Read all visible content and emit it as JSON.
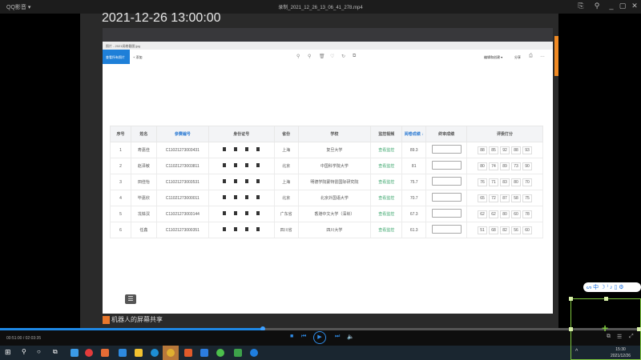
{
  "player": {
    "app_name": "QQ影音 ▾",
    "file_title": "录制_2021_12_26_13_06_41_278.mp4",
    "time": "00:51:00 / 02:03:35",
    "progress_percent": 41,
    "accent": "#1e88e5"
  },
  "video": {
    "timestamp": "2021-12-26 13:00:00",
    "inner_title": "照片 - 2021阅卷截图.jpg",
    "view_all": "查看所有照片",
    "add": "+ 添加",
    "edit": "编辑和创建 ▾",
    "share": "分享",
    "share_bar": "机器人的屏幕共享"
  },
  "table": {
    "headers": [
      "序号",
      "姓名",
      "参赛编号",
      "身份证号",
      "省份",
      "学校",
      "监控视频",
      "阅卷成绩 ↓",
      "终审成绩",
      "评委打分"
    ],
    "rows": [
      {
        "no": "1",
        "name": "寿嘉佳",
        "id": "C11021273003431",
        "prov": "上海",
        "school": "复旦大学",
        "video": "查看监控",
        "score": "89.3",
        "judges": [
          "88",
          "85",
          "92",
          "88",
          "93"
        ]
      },
      {
        "no": "2",
        "name": "赵泽敏",
        "id": "C11021273003811",
        "prov": "北京",
        "school": "中国科学院大学",
        "video": "查看监控",
        "score": "81",
        "judges": [
          "80",
          "74",
          "89",
          "73",
          "90"
        ]
      },
      {
        "no": "3",
        "name": "田佳怡",
        "id": "C11021273003531",
        "prov": "上海",
        "school": "明德学院蒙特雷国际研究院",
        "video": "查看监控",
        "score": "75.7",
        "judges": [
          "76",
          "71",
          "83",
          "80",
          "70"
        ]
      },
      {
        "no": "4",
        "name": "毕嘉欣",
        "id": "C11021273000011",
        "prov": "北京",
        "school": "北京外国语大学",
        "video": "查看监控",
        "score": "70.7",
        "judges": [
          "65",
          "72",
          "87",
          "58",
          "75"
        ]
      },
      {
        "no": "5",
        "name": "冼铢溟",
        "id": "C11021273003144",
        "prov": "广东省",
        "school": "香港中文大学（深圳）",
        "video": "查看监控",
        "score": "67.3",
        "judges": [
          "62",
          "62",
          "80",
          "60",
          "78"
        ]
      },
      {
        "no": "6",
        "name": "任鑫",
        "id": "C11021273000351",
        "prov": "四川省",
        "school": "四川大学",
        "video": "查看监控",
        "score": "61.3",
        "judges": [
          "51",
          "68",
          "82",
          "56",
          "60"
        ]
      }
    ]
  },
  "taskbar": {
    "time": "15:30",
    "date": "2021/12/26"
  }
}
